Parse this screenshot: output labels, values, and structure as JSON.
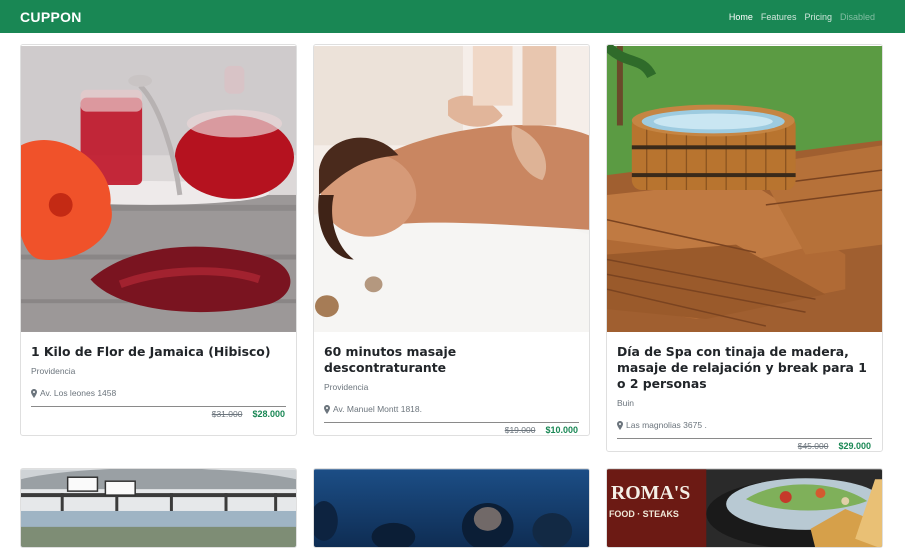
{
  "navbar": {
    "brand": "CUPPON",
    "links": [
      {
        "label": "Home",
        "state": "active"
      },
      {
        "label": "Features",
        "state": "normal"
      },
      {
        "label": "Pricing",
        "state": "normal"
      },
      {
        "label": "Disabled",
        "state": "disabled"
      }
    ]
  },
  "colors": {
    "brand": "#198754",
    "price_new": "#198754"
  },
  "cards": [
    {
      "title": "1 Kilo de Flor de Jamaica (Hibisco)",
      "city": "Providencia",
      "address": "Av. Los leones 1458",
      "price_old": "$31.000",
      "price_new": "$28.000",
      "image": "hibiscus-tea"
    },
    {
      "title": "60 minutos masaje descontraturante",
      "city": "Providencia",
      "address": "Av. Manuel Montt 1818.",
      "price_old": "$19.000",
      "price_new": "$10.000",
      "image": "massage"
    },
    {
      "title": "Día de Spa con tinaja de madera, masaje de relajación y break para 1 o 2 personas",
      "city": "Buin",
      "address": "Las magnolias 3675 .",
      "price_old": "$45.000",
      "price_new": "$29.000",
      "image": "wooden-hot-tub"
    },
    {
      "image": "greenhouse"
    },
    {
      "image": "concert-crowd"
    },
    {
      "image": "romas-restaurant",
      "image_text_top": "ROMA'S",
      "image_text_bottom": "FOOD · STEAKS"
    }
  ]
}
